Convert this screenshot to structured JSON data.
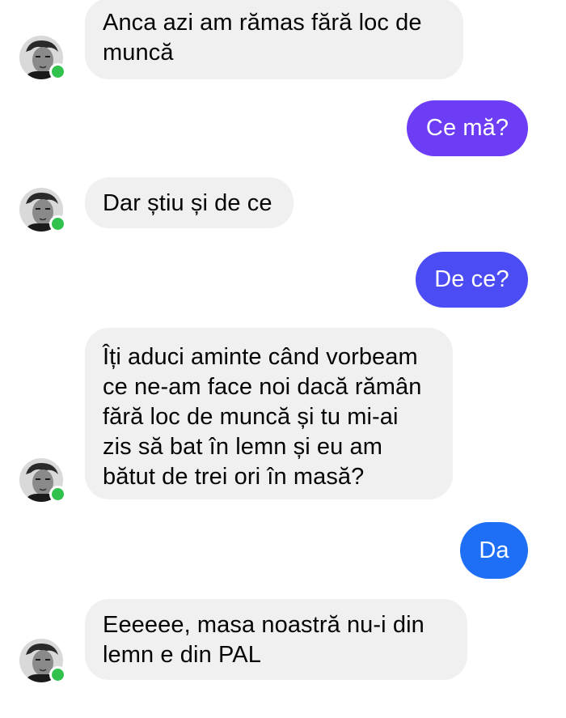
{
  "colors": {
    "incoming_bubble": "#f0f0f0",
    "online_indicator": "#31c24d",
    "outgoing_1": "#6c3df5",
    "outgoing_2": "#4b4cf3",
    "outgoing_3": "#1f6ff6"
  },
  "contact": {
    "avatar_icon": "user-avatar-icon",
    "status": "online"
  },
  "messages": [
    {
      "direction": "incoming",
      "lines": [
        "Anca azi am rămas fără loc de",
        "muncă"
      ]
    },
    {
      "direction": "outgoing",
      "text": "Ce mă?"
    },
    {
      "direction": "incoming",
      "lines": [
        "Dar știu și de ce"
      ]
    },
    {
      "direction": "outgoing",
      "text": "De ce?"
    },
    {
      "direction": "incoming",
      "lines": [
        "Îți aduci aminte când vorbeam",
        "ce ne-am face noi dacă rămân",
        "fără loc de muncă și tu mi-ai",
        "zis să bat în lemn și eu am",
        "bătut de trei ori în masă?"
      ]
    },
    {
      "direction": "outgoing",
      "text": "Da"
    },
    {
      "direction": "incoming",
      "lines": [
        "Eeeeee, masa noastră nu-i din",
        "lemn e din PAL"
      ]
    }
  ]
}
